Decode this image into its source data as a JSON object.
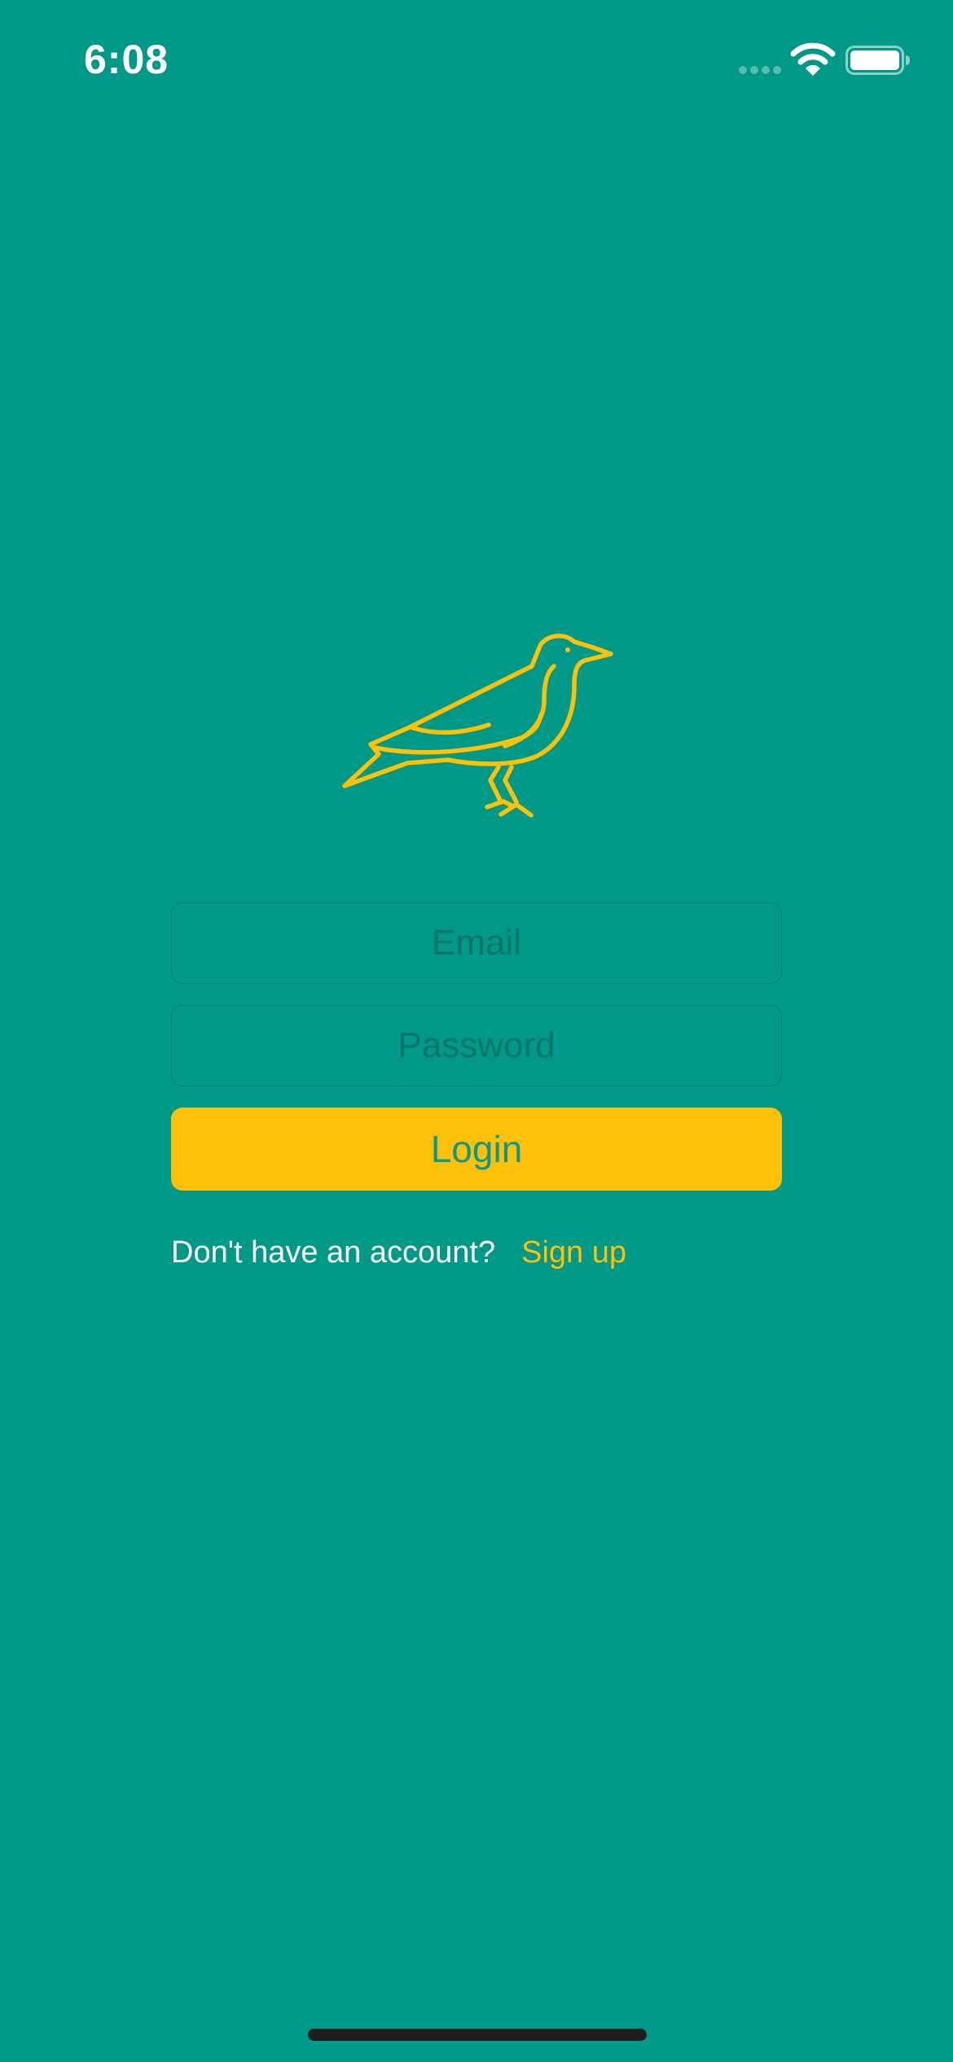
{
  "status_bar": {
    "time": "6:08",
    "icons": [
      "signal-icon",
      "wifi-icon",
      "battery-icon"
    ]
  },
  "logo": {
    "icon": "bird-logo-icon",
    "color": "#ffc107"
  },
  "form": {
    "email": {
      "placeholder": "Email",
      "value": ""
    },
    "password": {
      "placeholder": "Password",
      "value": ""
    },
    "login_label": "Login"
  },
  "signup": {
    "prompt": "Don't have an account?",
    "link_label": "Sign up"
  },
  "colors": {
    "background": "#009886",
    "accent": "#ffc107",
    "text_light": "#ffffff"
  }
}
